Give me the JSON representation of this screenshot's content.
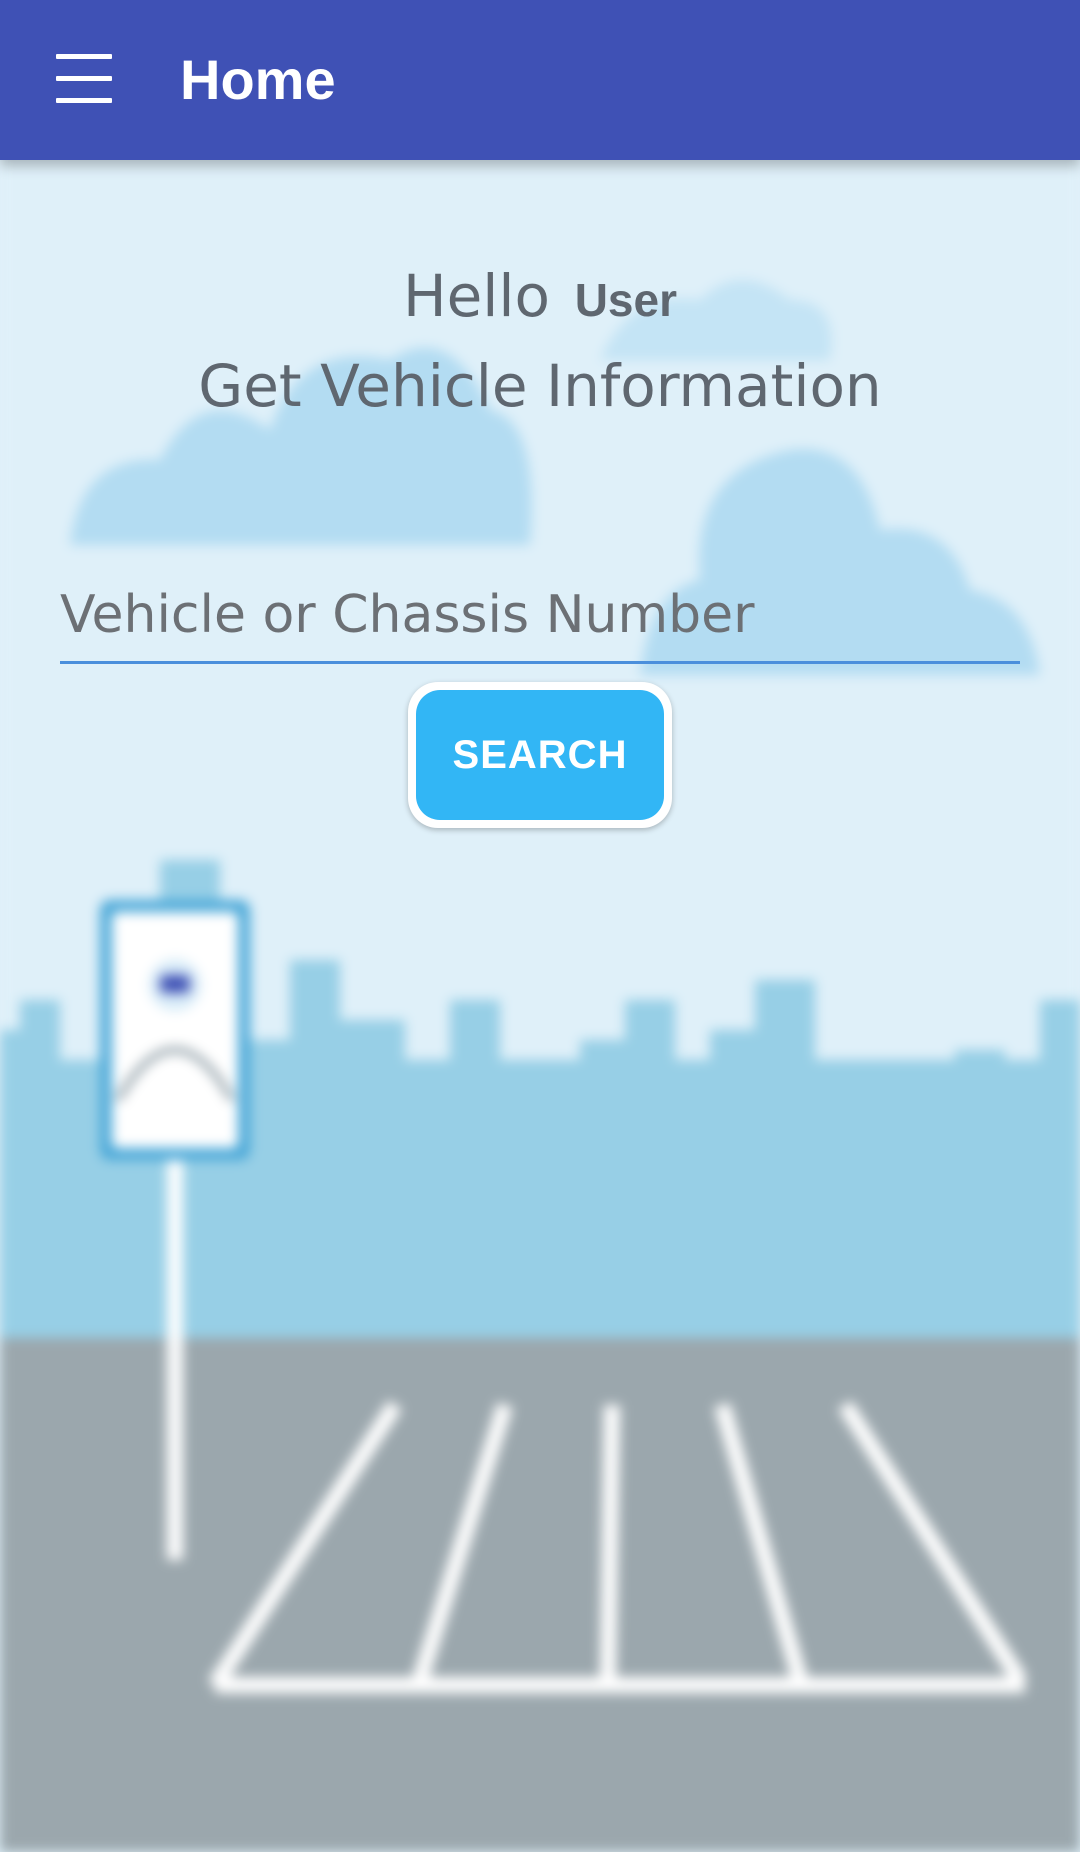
{
  "appbar": {
    "title": "Home",
    "menu_icon": "hamburger-menu-icon",
    "color": "#3f51b5"
  },
  "main": {
    "greeting_prefix": "Hello",
    "user_name": "User",
    "subtitle": "Get Vehicle Information",
    "input_placeholder": "Vehicle or Chassis Number",
    "input_value": "",
    "search_label": "SEARCH"
  },
  "colors": {
    "accent": "#32b6f5",
    "sky": "#dff0f9",
    "buildings": "#97cfe6",
    "road": "#9ba7ad",
    "text": "#5f6770"
  }
}
